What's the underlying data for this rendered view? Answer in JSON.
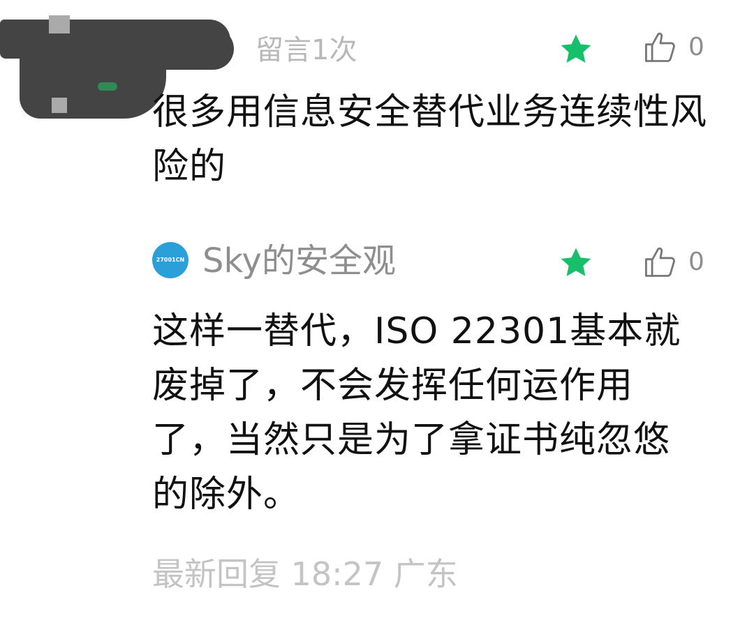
{
  "comments": [
    {
      "author_redacted": true,
      "meta": "留言1次",
      "featured_icon": "star-icon",
      "like_count": "0",
      "text": "很多用信息安全替代业务连续性风险的"
    },
    {
      "author": "Sky的安全观",
      "avatar_text": "27001CN",
      "featured_icon": "star-icon",
      "like_count": "0",
      "text": "这样一替代，ISO 22301基本就废掉了，不会发挥任何运作用了，当然只是为了拿证书纯忽悠的除外。",
      "reply_meta": "最新回复 18:27  广东"
    }
  ],
  "colors": {
    "star": "#16c06a",
    "meta_text": "#b8b8b8",
    "username": "#8e8e8e",
    "avatar_bg": "#2b9fd8"
  }
}
